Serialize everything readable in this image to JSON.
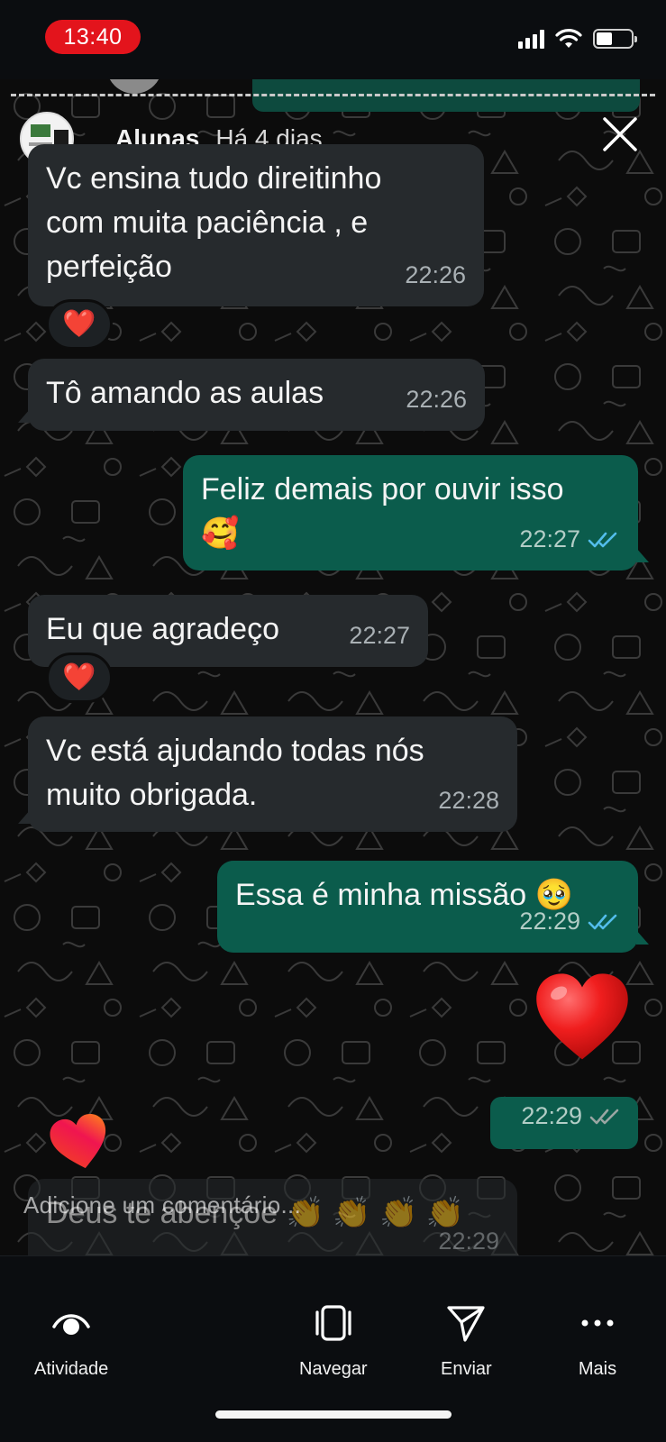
{
  "status_bar": {
    "time": "13:40"
  },
  "story": {
    "header": {
      "name": "Alunas",
      "age": "Há 4 dias"
    }
  },
  "messages": [
    {
      "direction": "in",
      "lines": [
        "Vc ensina tudo direitinho",
        "com muita paciência , e",
        "perfeição"
      ],
      "time": "22:26",
      "reaction": "❤️"
    },
    {
      "direction": "in",
      "lines": [
        "Tô amando as aulas"
      ],
      "time": "22:26"
    },
    {
      "direction": "out",
      "lines": [
        "Feliz demais por ouvir isso",
        "🥰"
      ],
      "time": "22:27",
      "status": "read"
    },
    {
      "direction": "in",
      "lines": [
        "Eu que agradeço"
      ],
      "time": "22:27",
      "reaction": "❤️"
    },
    {
      "direction": "in",
      "lines": [
        "Vc está ajudando todas nós",
        "muito obrigada."
      ],
      "time": "22:28"
    },
    {
      "direction": "out",
      "lines": [
        "Essa é minha missão 🥹"
      ],
      "time": "22:29",
      "status": "read"
    },
    {
      "direction": "out",
      "sticker": "red-heart",
      "time": "22:29",
      "status": "delivered"
    },
    {
      "direction": "in",
      "lines": [
        "Deus te abençoe 👏 👏 👏 👏"
      ],
      "time": "22:29",
      "partially_visible": true
    }
  ],
  "comment_input": {
    "placeholder": "Adicione um comentário..."
  },
  "bottom_nav": [
    {
      "label": "Atividade",
      "icon": "activity-eye-icon"
    },
    {
      "label": "Navegar",
      "icon": "browse-cards-icon"
    },
    {
      "label": "Enviar",
      "icon": "send-paper-plane-icon"
    },
    {
      "label": "Mais",
      "icon": "more-dots-icon"
    }
  ],
  "colors": {
    "status_pill": "#e3141c",
    "incoming_bubble": "#262a2d",
    "outgoing_bubble": "#0b5c4c",
    "read_ticks": "#53bdeb",
    "delivered_ticks": "#9aa6a3"
  }
}
